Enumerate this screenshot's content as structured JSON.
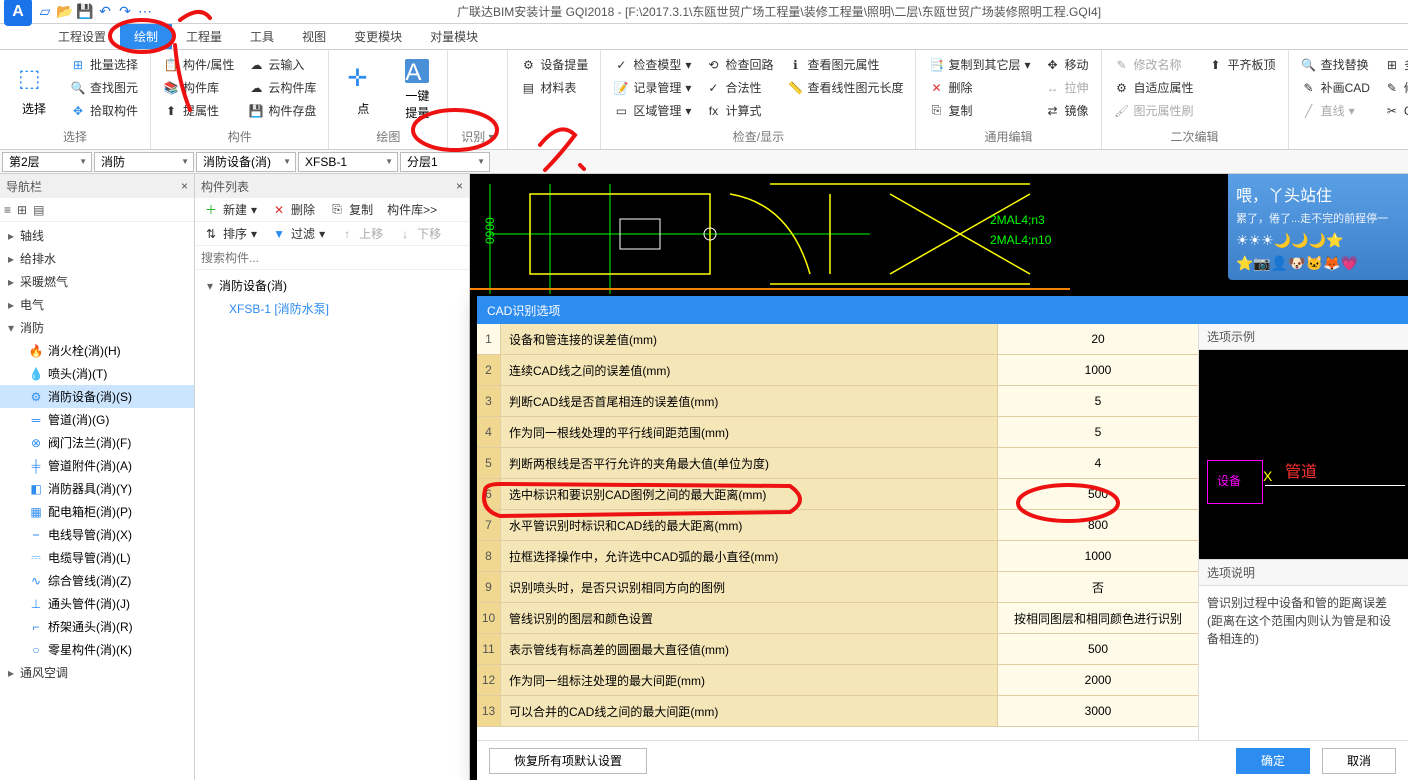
{
  "title": "广联达BIM安装计量 GQI2018 - [F:\\2017.3.1\\东瓯世贸广场工程量\\装修工程量\\照明\\二层\\东瓯世贸广场装修照明工程.GQI4]",
  "menus": [
    "工程设置",
    "绘制",
    "工程量",
    "工具",
    "视图",
    "变更模块",
    "对量模块"
  ],
  "ribbon": {
    "select_big": "选择",
    "g1": {
      "a": "批量选择",
      "b": "查找图元",
      "c": "拾取构件",
      "title": "选择"
    },
    "g2": {
      "a": "构件/属性",
      "b": "构件库",
      "c": "提属性",
      "d": "云输入",
      "e": "云构件库",
      "f": "构件存盘",
      "title": "构件"
    },
    "g3": {
      "a": "点",
      "b": "一键提量",
      "title": "绘图"
    },
    "g4": {
      "title": "识别"
    },
    "g5": {
      "a": "设备提量",
      "b": "材料表",
      "title": ""
    },
    "g6": {
      "a": "检查模型",
      "b": "记录管理",
      "c": "区域管理",
      "d": "检查回路",
      "e": "合法性",
      "f": "计算式",
      "g": "查看图元属性",
      "h": "查看线性图元长度",
      "title": "检查/显示"
    },
    "g7": {
      "a": "复制到其它层",
      "b": "删除",
      "c": "复制",
      "d": "移动",
      "e": "拉伸",
      "f": "镜像",
      "title": "通用编辑"
    },
    "g8": {
      "a": "修改名称",
      "b": "自适应属性",
      "c": "图元属性刷",
      "d": "平齐板顶",
      "title": "二次编辑"
    },
    "g9": {
      "a": "查找替换",
      "b": "补画CAD",
      "c": "直线",
      "d": "多视图",
      "e": "修改CAD标注",
      "f": "CAD线打断",
      "title": ""
    }
  },
  "dropdowns": {
    "floor": "第2层",
    "major": "消防",
    "type": "消防设备(消)",
    "comp": "XFSB-1",
    "layer": "分层1"
  },
  "nav": {
    "title": "导航栏",
    "items": [
      "轴线",
      "给排水",
      "采暖燃气",
      "电气",
      "消防"
    ],
    "fire_children": [
      {
        "ic": "🔥",
        "t": "消火栓(消)(H)"
      },
      {
        "ic": "💧",
        "t": "喷头(消)(T)"
      },
      {
        "ic": "⚙",
        "t": "消防设备(消)(S)",
        "sel": true
      },
      {
        "ic": "═",
        "t": "管道(消)(G)"
      },
      {
        "ic": "⊗",
        "t": "阀门法兰(消)(F)"
      },
      {
        "ic": "╪",
        "t": "管道附件(消)(A)"
      },
      {
        "ic": "◧",
        "t": "消防器具(消)(Y)"
      },
      {
        "ic": "▦",
        "t": "配电箱柜(消)(P)"
      },
      {
        "ic": "⎯",
        "t": "电线导管(消)(X)"
      },
      {
        "ic": "⎓",
        "t": "电缆导管(消)(L)"
      },
      {
        "ic": "∿",
        "t": "综合管线(消)(Z)"
      },
      {
        "ic": "⊥",
        "t": "通头管件(消)(J)"
      },
      {
        "ic": "⌐",
        "t": "桥架通头(消)(R)"
      },
      {
        "ic": "○",
        "t": "零星构件(消)(K)"
      }
    ],
    "after": [
      "通风空调"
    ]
  },
  "complist": {
    "title": "构件列表",
    "tb": {
      "new": "新建",
      "del": "删除",
      "copy": "复制",
      "lib": "构件库>>"
    },
    "tb2": {
      "sort": "排序",
      "filter": "过滤",
      "up": "上移",
      "down": "下移"
    },
    "search_ph": "搜索构件...",
    "root": "消防设备(消)",
    "item": "XFSB-1 [消防水泵]"
  },
  "notif": {
    "title": "喂，丫头站住",
    "sub": "累了，倦了...走不完的前程停一"
  },
  "dialog": {
    "title": "CAD识别选项",
    "rows": [
      {
        "n": "1",
        "l": "设备和管连接的误差值(mm)",
        "v": "20",
        "hl": true
      },
      {
        "n": "2",
        "l": "连续CAD线之间的误差值(mm)",
        "v": "1000"
      },
      {
        "n": "3",
        "l": "判断CAD线是否首尾相连的误差值(mm)",
        "v": "5"
      },
      {
        "n": "4",
        "l": "作为同一根线处理的平行线间距范围(mm)",
        "v": "5"
      },
      {
        "n": "5",
        "l": "判断两根线是否平行允许的夹角最大值(单位为度)",
        "v": "4"
      },
      {
        "n": "6",
        "l": "选中标识和要识别CAD图例之间的最大距离(mm)",
        "v": "500"
      },
      {
        "n": "7",
        "l": "水平管识别时标识和CAD线的最大距离(mm)",
        "v": "800"
      },
      {
        "n": "8",
        "l": "拉框选择操作中，允许选中CAD弧的最小直径(mm)",
        "v": "1000"
      },
      {
        "n": "9",
        "l": "识别喷头时，是否只识别相同方向的图例",
        "v": "否"
      },
      {
        "n": "10",
        "l": "管线识别的图层和颜色设置",
        "v": "按相同图层和相同颜色进行识别"
      },
      {
        "n": "11",
        "l": "表示管线有标高差的圆圈最大直径值(mm)",
        "v": "500"
      },
      {
        "n": "12",
        "l": "作为同一组标注处理的最大间距(mm)",
        "v": "2000"
      },
      {
        "n": "13",
        "l": "可以合并的CAD线之间的最大间距(mm)",
        "v": "3000"
      }
    ],
    "side": {
      "sec1": "选项示例",
      "lbl1": "设备",
      "lbl2": "管道",
      "sec2": "选项说明",
      "desc": "管识别过程中设备和管的距离误差(距离在这个范围内则认为管是和设备相连的)"
    },
    "foot": {
      "restore": "恢复所有项默认设置",
      "ok": "确定",
      "cancel": "取消"
    }
  },
  "cad_labels": {
    "a": "2MAL4;n3",
    "b": "2MAL4;n10",
    "dim": "0900"
  }
}
